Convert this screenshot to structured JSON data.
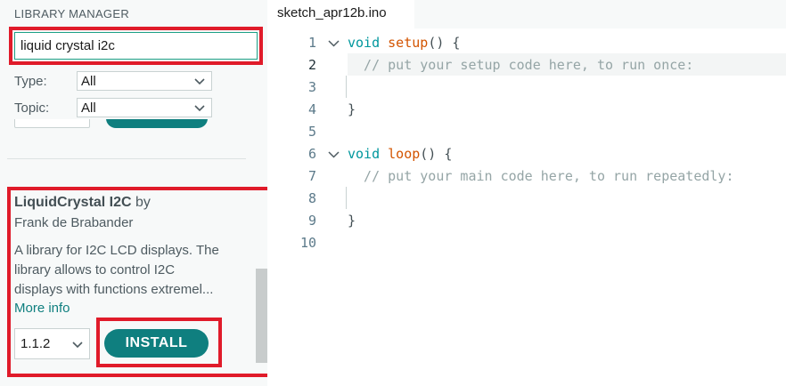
{
  "library_manager": {
    "title": "LIBRARY MANAGER",
    "search": {
      "value": "liquid crystal i2c"
    },
    "filters": [
      {
        "label": "Type:",
        "value": "All"
      },
      {
        "label": "Topic:",
        "value": "All"
      }
    ],
    "result": {
      "name": "LiquidCrystal I2C",
      "by": "by",
      "author": "Frank de Brabander",
      "description_lines": [
        "A library for I2C LCD displays. The",
        "library allows to control I2C",
        "displays with functions extremel..."
      ],
      "more_info": "More info",
      "version": "1.1.2",
      "install_label": "INSTALL"
    }
  },
  "editor": {
    "tab_title": "sketch_apr12b.ino",
    "active_line": 2,
    "lines": [
      {
        "n": "1",
        "fold": true,
        "parts": [
          {
            "t": "void",
            "c": "kw"
          },
          {
            "t": " ",
            "c": ""
          },
          {
            "t": "setup",
            "c": "fn"
          },
          {
            "t": "() {",
            "c": ""
          }
        ]
      },
      {
        "n": "2",
        "fold": false,
        "parts": [
          {
            "t": "  // put your setup code here, to run once:",
            "c": "cm"
          }
        ]
      },
      {
        "n": "3",
        "fold": false,
        "parts": []
      },
      {
        "n": "4",
        "fold": false,
        "parts": [
          {
            "t": "}",
            "c": ""
          }
        ]
      },
      {
        "n": "5",
        "fold": false,
        "parts": []
      },
      {
        "n": "6",
        "fold": true,
        "parts": [
          {
            "t": "void",
            "c": "kw"
          },
          {
            "t": " ",
            "c": ""
          },
          {
            "t": "loop",
            "c": "fn"
          },
          {
            "t": "() {",
            "c": ""
          }
        ]
      },
      {
        "n": "7",
        "fold": false,
        "parts": [
          {
            "t": "  // put your main code here, to run repeatedly:",
            "c": "cm"
          }
        ]
      },
      {
        "n": "8",
        "fold": false,
        "parts": []
      },
      {
        "n": "9",
        "fold": false,
        "parts": [
          {
            "t": "}",
            "c": ""
          }
        ]
      },
      {
        "n": "10",
        "fold": false,
        "parts": []
      }
    ]
  },
  "colors": {
    "accent": "#0f7f7f",
    "highlight_border": "#e01b2a",
    "keyword": "#00979d",
    "function": "#d35400",
    "comment": "#95a5a6"
  },
  "icons": {
    "select_caret": "chevron-down-icon",
    "fold_marker": "fold-chevron-icon"
  }
}
